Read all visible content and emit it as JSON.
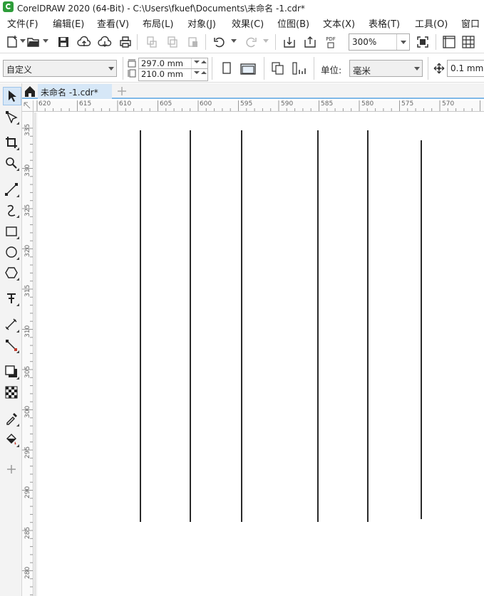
{
  "window": {
    "title": "CorelDRAW 2020 (64-Bit) - C:\\Users\\fkuef\\Documents\\未命名 -1.cdr*"
  },
  "menu": [
    "文件(F)",
    "编辑(E)",
    "查看(V)",
    "布局(L)",
    "对象(J)",
    "效果(C)",
    "位图(B)",
    "文本(X)",
    "表格(T)",
    "工具(O)",
    "窗口"
  ],
  "toolbar": {
    "pdf_label": "PDF",
    "zoom_value": "300%"
  },
  "property_bar": {
    "preset": "自定义",
    "width": "297.0 mm",
    "height": "210.0 mm",
    "unit_label": "单位:",
    "unit_value": "毫米",
    "nudge_value": "0.1 mm"
  },
  "document_tab": {
    "name": "未命名 -1.cdr*"
  },
  "ruler": {
    "h_ticks": [
      "620",
      "615",
      "610",
      "605",
      "600",
      "595",
      "590",
      "585",
      "580",
      "575",
      "570"
    ],
    "v_ticks": [
      "335",
      "330",
      "325",
      "320",
      "315",
      "310",
      "305",
      "300",
      "295",
      "290",
      "285",
      "280"
    ]
  },
  "tools": [
    "pick-tool",
    "shape-tool",
    "crop-tool",
    "zoom-tool",
    "freehand-tool",
    "artistic-media-tool",
    "rectangle-tool",
    "ellipse-tool",
    "polygon-tool",
    "text-tool",
    "parallel-dimension-tool",
    "connector-tool",
    "drop-shadow-tool",
    "transparency-tool",
    "color-eyedropper-tool",
    "interactive-fill-tool",
    "add-tool"
  ],
  "colors": {
    "accent": "#7fb9e8",
    "tab_active": "#d6e7f7",
    "logo": "#2e9d3a",
    "line": "#2a2a2a"
  }
}
